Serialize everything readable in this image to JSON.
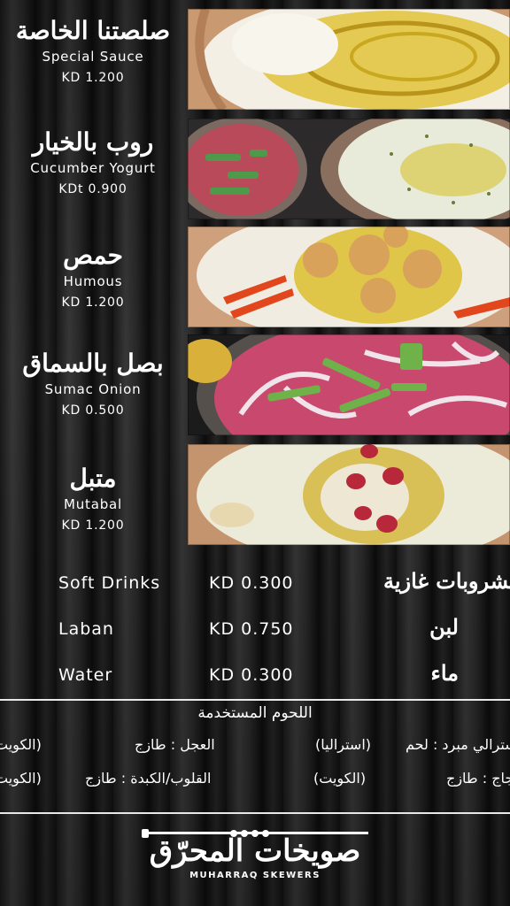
{
  "items": [
    {
      "ar": "صلصتنا الخاصة",
      "en": "Special Sauce",
      "price": "KD 1.200"
    },
    {
      "ar": "روب بالخيار",
      "en": "Cucumber Yogurt",
      "price": "KDt 0.900"
    },
    {
      "ar": "حمص",
      "en": "Humous",
      "price": "KD 1.200"
    },
    {
      "ar": "بصل بالسماق",
      "en": "Sumac Onion",
      "price": "KD 0.500"
    },
    {
      "ar": "متبل",
      "en": "Mutabal",
      "price": "KD 1.200"
    }
  ],
  "drinks": [
    {
      "name": "Soft Drinks",
      "price": "KD 0.300",
      "ar": "مشروبات غازية"
    },
    {
      "name": "Laban",
      "price": "KD 0.750",
      "ar": "لبن"
    },
    {
      "name": "Water",
      "price": "KD 0.300",
      "ar": "ماء"
    }
  ],
  "meats": {
    "title": "اللحوم المستخدمة",
    "row1": [
      "(الكويت",
      "العجل : طازج",
      "(استراليا)",
      "استرالي مبرد : لحم"
    ],
    "row2": [
      "(الكويت",
      "القلوب/الكبدة : طازج",
      "(الكويت)",
      "دجاج : طازج"
    ]
  },
  "logo": {
    "ar": "صويخات المحرّق",
    "en": "MUHARRAQ SKEWERS"
  },
  "colors": {
    "text": "#ffffff",
    "olive_oil": "#d4b21e",
    "paprika": "#e2461c",
    "background": "#1e1e1e"
  }
}
